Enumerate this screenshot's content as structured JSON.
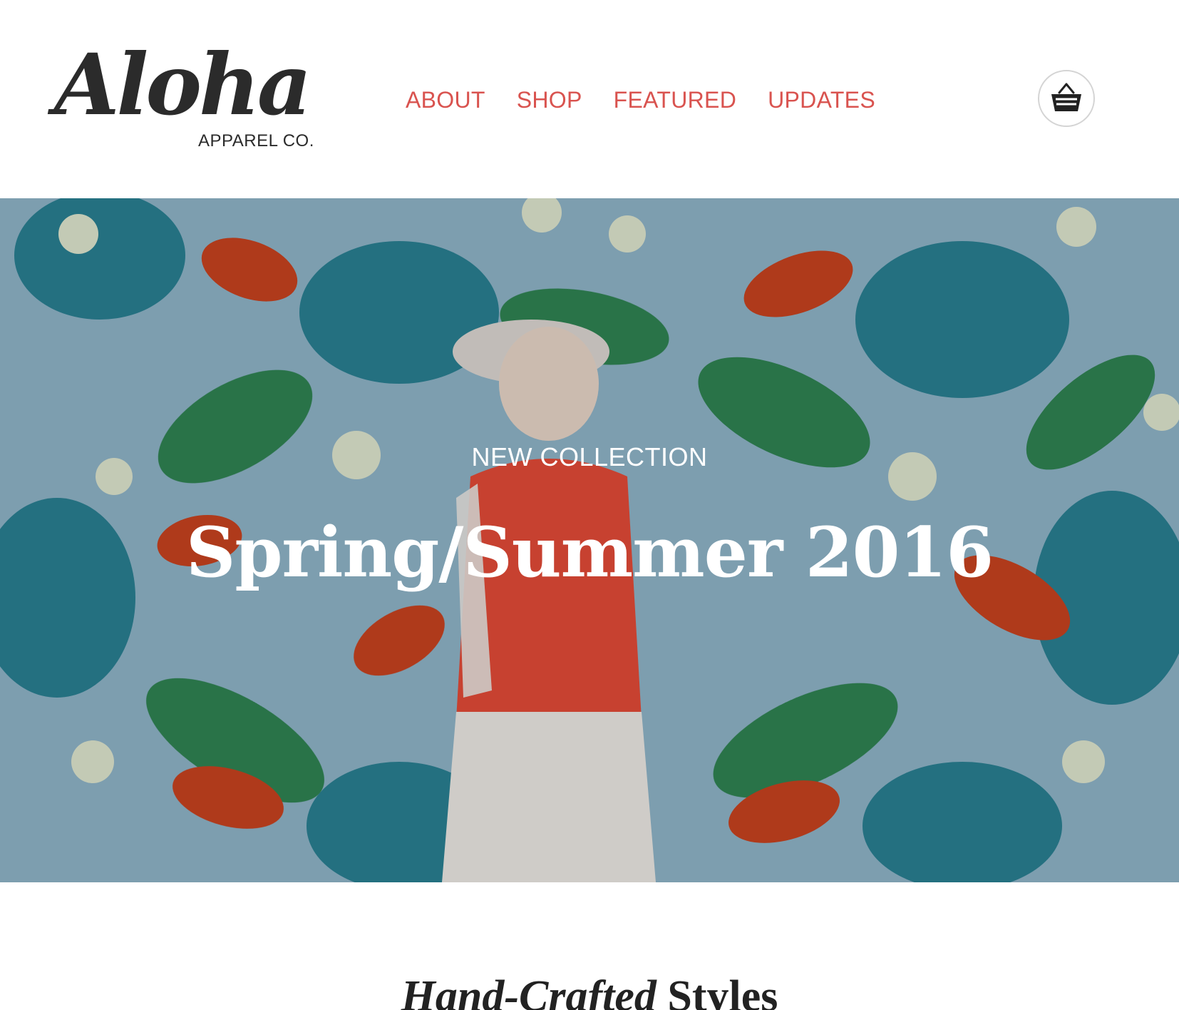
{
  "brand": {
    "logo_script": "Aloha",
    "logo_sub": "APPAREL CO."
  },
  "nav": {
    "items": [
      {
        "label": "ABOUT"
      },
      {
        "label": "SHOP"
      },
      {
        "label": "FEATURED"
      },
      {
        "label": "UPDATES"
      }
    ]
  },
  "cart": {
    "icon": "basket-icon"
  },
  "hero": {
    "eyebrow": "NEW COLLECTION",
    "title": "Spring/Summer 2016"
  },
  "section": {
    "title_italic": "Hand-Crafted",
    "title_bold": "Styles"
  },
  "colors": {
    "accent": "#d9534f",
    "hero_bg": "#8fb4c8"
  }
}
